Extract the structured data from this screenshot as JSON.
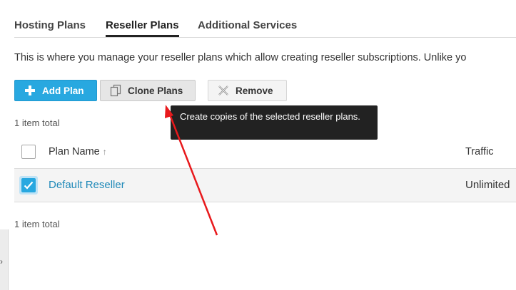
{
  "tabs": [
    {
      "label": "Hosting Plans"
    },
    {
      "label": "Reseller Plans"
    },
    {
      "label": "Additional Services"
    }
  ],
  "description": "This is where you manage your reseller plans which allow creating reseller subscriptions. Unlike yo",
  "toolbar": {
    "add_label": "Add Plan",
    "clone_label": "Clone Plans",
    "remove_label": "Remove"
  },
  "tooltip": {
    "text": "Create copies of the selected reseller plans."
  },
  "summary": {
    "top": "1 item total",
    "bottom": "1 item total"
  },
  "table": {
    "columns": [
      {
        "label": "Plan Name",
        "sort": "↑"
      },
      {
        "label": "Traffic"
      }
    ],
    "rows": [
      {
        "name": "Default Reseller",
        "traffic": "Unlimited",
        "checked": true
      }
    ]
  },
  "colors": {
    "accent": "#28a8e0",
    "link": "#1f89b8",
    "tooltip_bg": "#222222",
    "annotation_arrow": "#e8191c"
  },
  "icons": {
    "add": "plus-icon",
    "clone": "copy-icon",
    "remove": "x-icon",
    "side": "chevron-right-icon"
  }
}
